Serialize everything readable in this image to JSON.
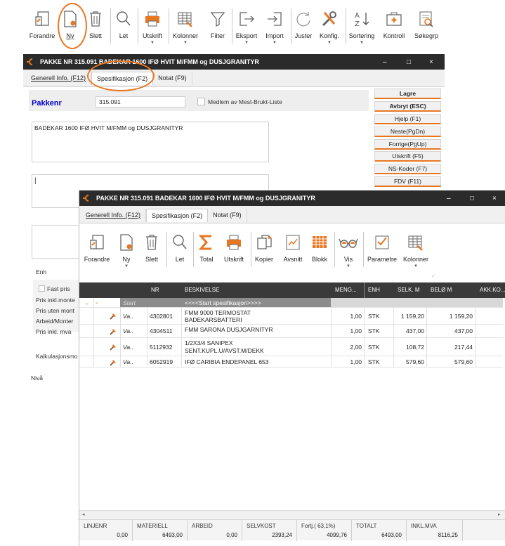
{
  "top_toolbar": {
    "items": [
      {
        "label": "Forandre",
        "icon": "edit-icon"
      },
      {
        "label": "Ny",
        "icon": "new-document-icon"
      },
      {
        "label": "Slett",
        "icon": "trash-icon"
      },
      {
        "label": "Let",
        "icon": "search-icon"
      },
      {
        "label": "Utskrift",
        "icon": "printer-icon"
      },
      {
        "label": "Kolonner",
        "icon": "columns-icon"
      },
      {
        "label": "Filter",
        "icon": "filter-icon"
      },
      {
        "label": "Eksport",
        "icon": "export-icon"
      },
      {
        "label": "Import",
        "icon": "import-icon"
      },
      {
        "label": "Juster",
        "icon": "refresh-icon"
      },
      {
        "label": "Konfig.",
        "icon": "tools-icon"
      },
      {
        "label": "Sortering",
        "icon": "sort-icon"
      },
      {
        "label": "Kontroll",
        "icon": "first-aid-icon"
      },
      {
        "label": "Søkegrp",
        "icon": "search-group-icon"
      }
    ]
  },
  "window1": {
    "title": "PAKKE NR 315.091 BADEKAR 1600 IFØ HVIT M/FMM og DUSJGRANITYR",
    "controls": {
      "minimize": "–",
      "maximize": "□",
      "close": "×"
    },
    "tabs": [
      "Generell Info. (F12)",
      "Spesifikasjon (F2)",
      "Notat (F9)"
    ],
    "pakkenr_label": "Pakkenr",
    "pakkenr_value": "315.091",
    "medlem_label": "Medlem av Mest-Brukt-Liste",
    "description": "BADEKAR 1600 IFØ HVIT M/FMM og DUSJGRANITYR",
    "buttons": [
      "Lagre",
      "Avbryt (ESC)",
      "Hjelp (F1)",
      "Neste(PgDn)",
      "Forrige(PgUp)",
      "Utskrift (F5)",
      "NS-Koder (F7)",
      "FDV (F11)"
    ],
    "labels": {
      "enh": "Enh",
      "fast_pris": "Fast pris",
      "pris_inkl": "Pris inkl.monte",
      "pris_uten": "Pris uten mont",
      "arbeid": "Arbeid/Monter",
      "pris_mva": "Pris inkl. mva",
      "kalk": "Kalkulasjonsmo",
      "niva": "Nivå"
    }
  },
  "window2": {
    "title": "PAKKE NR 315.091 BADEKAR 1600 IFØ HVIT M/FMM og DUSJGRANITYR",
    "controls": {
      "minimize": "–",
      "maximize": "□",
      "close": "×"
    },
    "tabs": [
      "Generell Info. (F12)",
      "Spesifikasjon (F2)",
      "Notat (F9)"
    ],
    "toolbar": [
      {
        "label": "Forandre",
        "icon": "edit-icon"
      },
      {
        "label": "Ny",
        "icon": "new-document-icon"
      },
      {
        "label": "Slett",
        "icon": "trash-icon"
      },
      {
        "label": "Let",
        "icon": "search-icon"
      },
      {
        "label": "Total",
        "icon": "sum-icon"
      },
      {
        "label": "Utskrift",
        "icon": "printer-icon"
      },
      {
        "label": "Kopier",
        "icon": "copy-icon"
      },
      {
        "label": "Avsnitt",
        "icon": "chart-icon"
      },
      {
        "label": "Blokk",
        "icon": "grid-icon"
      },
      {
        "label": "Vis",
        "icon": "glasses-icon"
      },
      {
        "label": "Parametre",
        "icon": "checklist-icon"
      },
      {
        "label": "Kolonner",
        "icon": "columns-icon"
      }
    ],
    "grid": {
      "headers": [
        "NR",
        "BESKIVELSE",
        "MENG...",
        "ENH",
        "SELK. M",
        "BELØ M",
        "AKK.KO..."
      ],
      "start_row": {
        "type": "Start",
        "desc": "<<<<Start spesifikasjon>>>>"
      },
      "rows": [
        {
          "type": "Va..",
          "nr": "4302801",
          "desc": [
            "FMM 9000 TERMOSTAT",
            "BADEKARSBATTERI"
          ],
          "qty": "1,00",
          "unit": "STK",
          "cost": "1 159,20",
          "amount": "1 159,20"
        },
        {
          "type": "Va..",
          "nr": "4304511",
          "desc": [
            "FMM SARONA DUSJGARNITYR"
          ],
          "qty": "1,00",
          "unit": "STK",
          "cost": "437,00",
          "amount": "437,00"
        },
        {
          "type": "Va..",
          "nr": "5112932",
          "desc": [
            "1/2X3/4 SANIPEX",
            "SENT.KUPL.U/AVST.M/DEKK"
          ],
          "qty": "2,00",
          "unit": "STK",
          "cost": "108,72",
          "amount": "217,44"
        },
        {
          "type": "Va..",
          "nr": "6052919",
          "desc": [
            "IFØ CARIBIA ENDEPANEL 653"
          ],
          "qty": "1,00",
          "unit": "STK",
          "cost": "579,60",
          "amount": "579,60"
        }
      ]
    },
    "footer": [
      {
        "label": "LINJENR",
        "value": "0,00"
      },
      {
        "label": "MATERIELL",
        "value": "6493,00"
      },
      {
        "label": "ARBEID",
        "value": "0,00"
      },
      {
        "label": "SELVKOST",
        "value": "2393,24"
      },
      {
        "label": "Fortj.( 63,1%)",
        "value": "4099,76"
      },
      {
        "label": "TOTALT",
        "value": "6493,00"
      },
      {
        "label": "INKL.MVA",
        "value": "8116,25"
      }
    ]
  },
  "colors": {
    "accent": "#e87722",
    "titlebar": "#2b2b2b",
    "grid_header": "#3a3a3a",
    "blue_label": "#0000cc"
  }
}
